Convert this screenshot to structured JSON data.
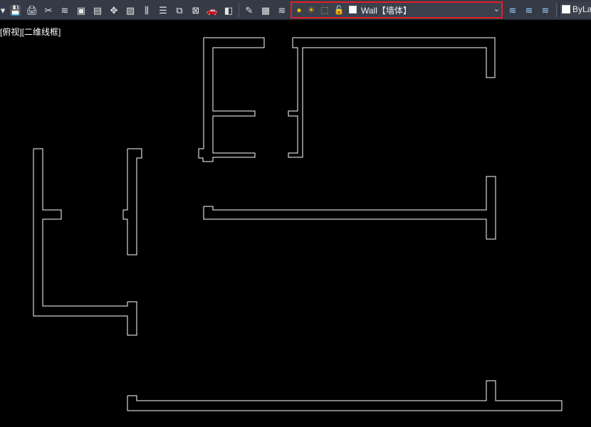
{
  "toolbar": {
    "icons": [
      {
        "name": "arrow-icon",
        "glyph": "▾"
      },
      {
        "name": "save-icon",
        "glyph": "💾"
      },
      {
        "name": "print-icon",
        "glyph": "🖨"
      },
      {
        "name": "tools-icon",
        "glyph": "✂"
      },
      {
        "name": "layer-state-icon",
        "glyph": "≋"
      },
      {
        "name": "zoom-extents-icon",
        "glyph": "▣"
      },
      {
        "name": "book-icon",
        "glyph": "▤"
      },
      {
        "name": "move-icon",
        "glyph": "✥"
      },
      {
        "name": "hatch-icon",
        "glyph": "▨"
      },
      {
        "name": "column-icon",
        "glyph": "⫼"
      },
      {
        "name": "stack-icon",
        "glyph": "☰"
      },
      {
        "name": "layer-tool-icon",
        "glyph": "⧉"
      },
      {
        "name": "delete-layer-icon",
        "glyph": "⊠"
      },
      {
        "name": "car-icon",
        "glyph": "🚗"
      },
      {
        "name": "fill-icon",
        "glyph": "◧"
      },
      {
        "name": "edit-icon",
        "glyph": "✎"
      },
      {
        "name": "calculator-icon",
        "glyph": "▦"
      },
      {
        "name": "layer-manager-icon",
        "glyph": "≋"
      }
    ],
    "layer": {
      "name": "Wall【墙体】",
      "bulb_icon": "●",
      "sun_icon": "☀",
      "freeze_icon": "⬚",
      "lock_icon": "🔓",
      "dropdown_icon": "⌄"
    },
    "right_icons": [
      {
        "name": "layer-previous-icon",
        "glyph": "≋"
      },
      {
        "name": "layer-walk-icon",
        "glyph": "≋"
      },
      {
        "name": "layer-iso-icon",
        "glyph": "≋"
      }
    ],
    "color_control": {
      "label": "ByLa"
    }
  },
  "viewport": {
    "label": "[俯视][二维线框]"
  },
  "colors": {
    "toolbar_bg": "#343a46",
    "canvas_bg": "#000000",
    "linework": "#ffffff",
    "highlight": "#e0202a"
  }
}
